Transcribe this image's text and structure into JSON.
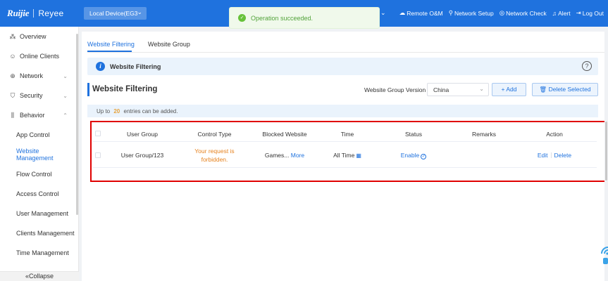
{
  "brand": {
    "name": "Ruijie",
    "subname": "Reyee"
  },
  "header": {
    "device": "Local Device(EG3",
    "nav": [
      {
        "label": "Remote O&M",
        "icon": "cloud-icon"
      },
      {
        "label": "Network Setup",
        "icon": "network-setup-icon"
      },
      {
        "label": "Network Check",
        "icon": "network-check-icon"
      },
      {
        "label": "Alert",
        "icon": "bell-icon"
      },
      {
        "label": "Log Out",
        "icon": "logout-icon"
      }
    ]
  },
  "toast": {
    "message": "Operation succeeded."
  },
  "sidebar": {
    "items": [
      {
        "label": "Overview",
        "icon": "overview-icon"
      },
      {
        "label": "Online Clients",
        "icon": "user-icon"
      },
      {
        "label": "Network",
        "icon": "globe-icon"
      },
      {
        "label": "Security",
        "icon": "shield-icon"
      },
      {
        "label": "Behavior",
        "icon": "behavior-icon"
      }
    ],
    "sub_items": [
      {
        "label": "App Control"
      },
      {
        "label": "Website Management"
      },
      {
        "label": "Flow Control"
      },
      {
        "label": "Access Control"
      },
      {
        "label": "User Management"
      },
      {
        "label": "Clients Management"
      },
      {
        "label": "Time Management"
      }
    ],
    "collapse_label": "Collapse"
  },
  "tabs": [
    {
      "label": "Website Filtering",
      "active": true
    },
    {
      "label": "Website Group",
      "active": false
    }
  ],
  "info_bar": {
    "title": "Website Filtering"
  },
  "section": {
    "title": "Website Filtering",
    "group_version_label": "Website Group Version",
    "group_version_value": "China",
    "add_label": "Add",
    "delete_selected_label": "Delete Selected"
  },
  "limit": {
    "prefix": "Up to",
    "count": "20",
    "suffix": "entries can be added."
  },
  "table": {
    "headers": [
      "User Group",
      "Control Type",
      "Blocked Website",
      "Time",
      "Status",
      "Remarks",
      "Action"
    ],
    "rows": [
      {
        "user_group": "User Group/123",
        "control_type_line1": "Your request is",
        "control_type_line2": "forbidden.",
        "blocked_website": "Games...",
        "more": "More",
        "time": "All Time",
        "status": "Enable",
        "remarks": "",
        "edit": "Edit",
        "delete": "Delete"
      }
    ]
  },
  "colors": {
    "primary": "#1f72de",
    "success": "#67c23a",
    "warning": "#e6821e",
    "highlight": "#e00000"
  }
}
